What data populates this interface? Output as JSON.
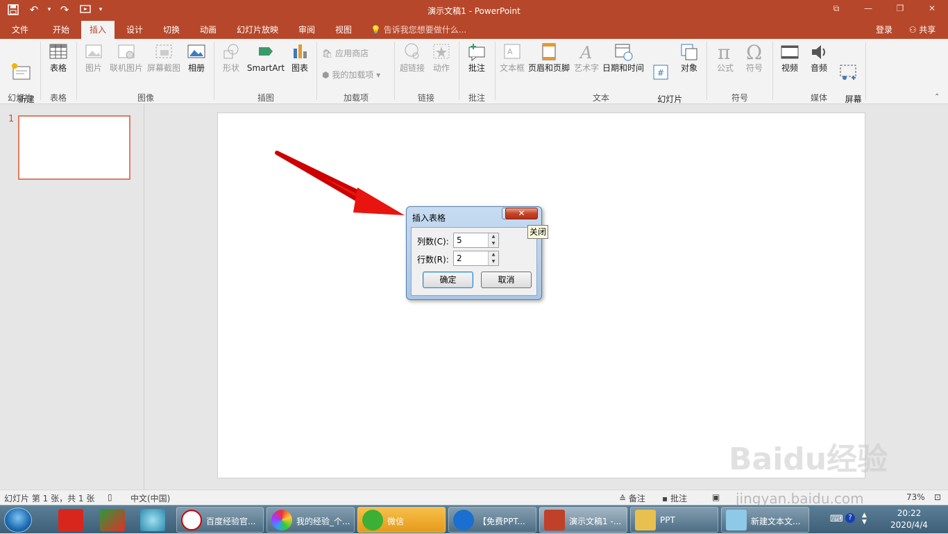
{
  "window": {
    "title": "演示文稿1 - PowerPoint",
    "restore_btn": "⧉",
    "min_btn": "—",
    "max_btn": "❐",
    "close_btn": "✕"
  },
  "tabs": [
    "文件",
    "开始",
    "插入",
    "设计",
    "切换",
    "动画",
    "幻灯片放映",
    "审阅",
    "视图"
  ],
  "active_tab": "插入",
  "tell_me": "告诉我您想要做什么...",
  "login": "登录",
  "share": "共享",
  "ribbon": {
    "new_slide": "新建\n幻灯片",
    "table": "表格",
    "picture": "图片",
    "online_picture": "联机图片",
    "screenshot": "屏幕截图",
    "album": "相册",
    "shapes": "形状",
    "smartart": "SmartArt",
    "chart": "图表",
    "store": "应用商店",
    "my_addins": "我的加载项",
    "hyperlink": "超链接",
    "action": "动作",
    "comment": "批注",
    "textbox": "文本框",
    "header_footer": "页眉和页脚",
    "wordart": "艺术字",
    "datetime": "日期和时间",
    "slide_number": "幻灯片\n编号",
    "object": "对象",
    "equation": "公式",
    "symbol": "符号",
    "video": "视频",
    "audio": "音频",
    "screen_record": "屏幕\n录制",
    "groups": [
      "幻灯片",
      "表格",
      "图像",
      "插图",
      "加载项",
      "链接",
      "批注",
      "文本",
      "符号",
      "媒体"
    ]
  },
  "thumb": {
    "number": "1"
  },
  "dialog": {
    "title": "插入表格",
    "help": "?",
    "close": "✕",
    "cols_label": "列数(C):",
    "cols_value": "5",
    "rows_label": "行数(R):",
    "rows_value": "2",
    "ok": "确定",
    "cancel": "取消",
    "tooltip": "关闭"
  },
  "status": {
    "slide_info": "幻灯片 第 1 张，共 1 张",
    "language": "中文(中国)",
    "notes": "备注",
    "comments": "批注",
    "zoom": "73%"
  },
  "taskbar": {
    "items": [
      "百度经验官...",
      "我的经验_个...",
      "微信",
      "【免费PPT...",
      "演示文稿1 -...",
      "PPT",
      "新建文本文..."
    ],
    "time": "20:22",
    "date": "2020/4/4"
  },
  "watermark": {
    "brand": "Baidu经验",
    "url": "jingyan.baidu.com"
  }
}
